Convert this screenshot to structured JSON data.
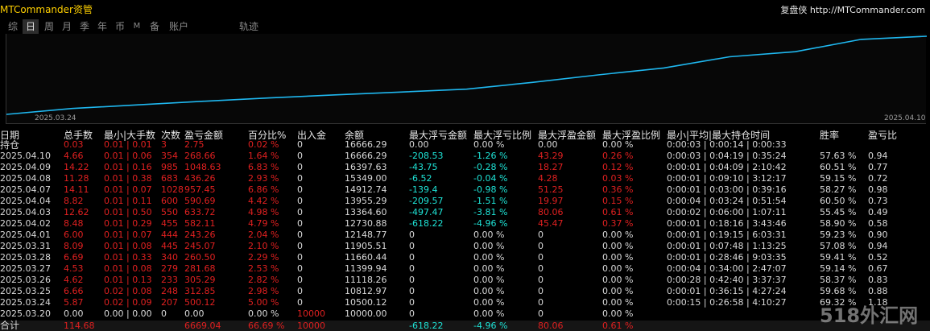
{
  "app": {
    "title": "MTCommander资管",
    "brand": "复盘侠 http://MTCommander.com"
  },
  "tabs": [
    {
      "label": "综",
      "active": false
    },
    {
      "label": "日",
      "active": true
    },
    {
      "label": "周",
      "active": false
    },
    {
      "label": "月",
      "active": false
    },
    {
      "label": "季",
      "active": false
    },
    {
      "label": "年",
      "active": false
    },
    {
      "label": "币",
      "active": false
    },
    {
      "label": "M",
      "active": false
    },
    {
      "label": "备",
      "active": false
    },
    {
      "label": "账户",
      "active": false
    },
    {
      "label": "轨迹",
      "active": false
    }
  ],
  "equity_chart": {
    "start_date": "2025.03.24",
    "end_date": "2025.04.10",
    "line_color": "#1fb8f0"
  },
  "table": {
    "headers": [
      "日期",
      "总手数",
      "最小|大手数",
      "次数",
      "盈亏金额",
      "百分比%",
      "出入金",
      "余额",
      "最大浮亏金额",
      "最大浮亏比例",
      "最大浮盈金额",
      "最大浮盈比例",
      "最小|平均|最大持仓时间",
      "胜率",
      "盈亏比"
    ],
    "holding_row": {
      "label": "持仓",
      "lots": "0.03",
      "min_max": "0.01 | 0.01",
      "count": "3",
      "pnl": "2.75",
      "pct": "0.02 %",
      "cash": "0",
      "balance": "16666.29",
      "max_float_loss": "0.00",
      "max_float_loss_pct": "0.00 %",
      "max_float_profit": "0.00",
      "max_float_profit_pct": "0.00 %",
      "hold_time": "0:00:03 | 0:00:14 | 0:00:33",
      "win_rate": "",
      "pl_ratio": ""
    },
    "rows": [
      {
        "date": "2025.04.10",
        "lots": "4.66",
        "min_max": "0.01 | 0.06",
        "count": "354",
        "pnl": "268.66",
        "pct": "1.64 %",
        "cash": "0",
        "balance": "16666.29",
        "mfl": "-208.53",
        "mflp": "-1.26 %",
        "mfp": "43.29",
        "mfpp": "0.26 %",
        "time": "0:00:03 | 0:04:19 | 0:35:24",
        "win": "57.63 %",
        "plr": "0.94",
        "pos": true
      },
      {
        "date": "2025.04.09",
        "lots": "14.22",
        "min_max": "0.01 | 0.16",
        "count": "985",
        "pnl": "1048.63",
        "pct": "6.83 %",
        "cash": "0",
        "balance": "16397.63",
        "mfl": "-43.75",
        "mflp": "-0.28 %",
        "mfp": "18.27",
        "mfpp": "0.12 %",
        "time": "0:00:01 | 0:04:09 | 2:10:42",
        "win": "60.51 %",
        "plr": "0.77",
        "pos": true
      },
      {
        "date": "2025.04.08",
        "lots": "11.28",
        "min_max": "0.01 | 0.38",
        "count": "683",
        "pnl": "436.26",
        "pct": "2.93 %",
        "cash": "0",
        "balance": "15349.00",
        "mfl": "-6.52",
        "mflp": "-0.04 %",
        "mfp": "4.28",
        "mfpp": "0.03 %",
        "time": "0:00:01 | 0:09:10 | 3:12:17",
        "win": "59.15 %",
        "plr": "0.72",
        "pos": true
      },
      {
        "date": "2025.04.07",
        "lots": "14.11",
        "min_max": "0.01 | 0.07",
        "count": "1028",
        "pnl": "957.45",
        "pct": "6.86 %",
        "cash": "0",
        "balance": "14912.74",
        "mfl": "-139.4",
        "mflp": "-0.98 %",
        "mfp": "51.25",
        "mfpp": "0.36 %",
        "time": "0:00:01 | 0:03:00 | 0:39:16",
        "win": "58.27 %",
        "plr": "0.98",
        "pos": true
      },
      {
        "date": "2025.04.04",
        "lots": "8.82",
        "min_max": "0.01 | 0.11",
        "count": "600",
        "pnl": "590.69",
        "pct": "4.42 %",
        "cash": "0",
        "balance": "13955.29",
        "mfl": "-209.57",
        "mflp": "-1.51 %",
        "mfp": "19.97",
        "mfpp": "0.15 %",
        "time": "0:00:04 | 0:03:24 | 0:51:54",
        "win": "60.50 %",
        "plr": "0.73",
        "pos": true
      },
      {
        "date": "2025.04.03",
        "lots": "12.62",
        "min_max": "0.01 | 0.50",
        "count": "550",
        "pnl": "633.72",
        "pct": "4.98 %",
        "cash": "0",
        "balance": "13364.60",
        "mfl": "-497.47",
        "mflp": "-3.81 %",
        "mfp": "80.06",
        "mfpp": "0.61 %",
        "time": "0:00:02 | 0:06:00 | 1:07:11",
        "win": "55.45 %",
        "plr": "0.49",
        "pos": true
      },
      {
        "date": "2025.04.02",
        "lots": "8.48",
        "min_max": "0.01 | 0.29",
        "count": "455",
        "pnl": "582.11",
        "pct": "4.79 %",
        "cash": "0",
        "balance": "12730.88",
        "mfl": "-618.22",
        "mflp": "-4.96 %",
        "mfp": "45.47",
        "mfpp": "0.37 %",
        "time": "0:00:01 | 0:18:16 | 3:43:46",
        "win": "58.90 %",
        "plr": "0.58",
        "pos": true
      },
      {
        "date": "2025.04.01",
        "lots": "6.00",
        "min_max": "0.01 | 0.07",
        "count": "444",
        "pnl": "243.26",
        "pct": "2.04 %",
        "cash": "0",
        "balance": "12148.77",
        "mfl": "0",
        "mflp": "0.00 %",
        "mfp": "0",
        "mfpp": "0.00 %",
        "time": "0:00:01 | 0:19:15 | 6:03:31",
        "win": "59.23 %",
        "plr": "0.90",
        "pos": true
      },
      {
        "date": "2025.03.31",
        "lots": "8.09",
        "min_max": "0.01 | 0.08",
        "count": "445",
        "pnl": "245.07",
        "pct": "2.10 %",
        "cash": "0",
        "balance": "11905.51",
        "mfl": "0",
        "mflp": "0.00 %",
        "mfp": "0",
        "mfpp": "0.00 %",
        "time": "0:00:01 | 0:07:48 | 1:13:25",
        "win": "57.08 %",
        "plr": "0.94",
        "pos": true
      },
      {
        "date": "2025.03.28",
        "lots": "6.69",
        "min_max": "0.01 | 0.33",
        "count": "340",
        "pnl": "260.50",
        "pct": "2.29 %",
        "cash": "0",
        "balance": "11660.44",
        "mfl": "0",
        "mflp": "0.00 %",
        "mfp": "0",
        "mfpp": "0.00 %",
        "time": "0:00:01 | 0:28:46 | 9:03:35",
        "win": "59.41 %",
        "plr": "0.52",
        "pos": true
      },
      {
        "date": "2025.03.27",
        "lots": "4.53",
        "min_max": "0.01 | 0.08",
        "count": "279",
        "pnl": "281.68",
        "pct": "2.53 %",
        "cash": "0",
        "balance": "11399.94",
        "mfl": "0",
        "mflp": "0.00 %",
        "mfp": "0",
        "mfpp": "0.00 %",
        "time": "0:00:04 | 0:34:00 | 2:47:07",
        "win": "59.14 %",
        "plr": "0.67",
        "pos": true
      },
      {
        "date": "2025.03.26",
        "lots": "4.62",
        "min_max": "0.01 | 0.13",
        "count": "233",
        "pnl": "305.29",
        "pct": "2.82 %",
        "cash": "0",
        "balance": "11118.26",
        "mfl": "0",
        "mflp": "0.00 %",
        "mfp": "0",
        "mfpp": "0.00 %",
        "time": "0:00:28 | 0:42:40 | 3:37:37",
        "win": "58.37 %",
        "plr": "0.83",
        "pos": true
      },
      {
        "date": "2025.03.25",
        "lots": "6.66",
        "min_max": "0.02 | 0.08",
        "count": "248",
        "pnl": "312.85",
        "pct": "2.98 %",
        "cash": "0",
        "balance": "10812.97",
        "mfl": "0",
        "mflp": "0.00 %",
        "mfp": "0",
        "mfpp": "0.00 %",
        "time": "0:00:01 | 0:36:15 | 4:27:24",
        "win": "59.68 %",
        "plr": "0.88",
        "pos": true
      },
      {
        "date": "2025.03.24",
        "lots": "5.87",
        "min_max": "0.02 | 0.09",
        "count": "207",
        "pnl": "500.12",
        "pct": "5.00 %",
        "cash": "0",
        "balance": "10500.12",
        "mfl": "0",
        "mflp": "0.00 %",
        "mfp": "0",
        "mfpp": "0.00 %",
        "time": "0:00:15 | 0:26:58 | 4:10:27",
        "win": "69.32 %",
        "plr": "1.18",
        "pos": true
      },
      {
        "date": "2025.03.20",
        "lots": "0.00",
        "min_max": "0.00 | 0.00",
        "count": "0",
        "pnl": "0.00",
        "pct": "0.00 %",
        "cash": "10000",
        "balance": "10000.00",
        "mfl": "0",
        "mflp": "0.00 %",
        "mfp": "0",
        "mfpp": "0.00 %",
        "time": "",
        "win": "",
        "plr": "",
        "pos": false
      }
    ],
    "total": {
      "label": "合计",
      "lots": "114.68",
      "pnl": "6669.04",
      "pct": "66.69 %",
      "cash": "10000",
      "mfl": "-618.22",
      "mflp": "-4.96 %",
      "mfp": "80.06",
      "mfpp": "0.61 %"
    }
  },
  "watermark": "518外汇网",
  "colors": {
    "positive": "#e02020",
    "negative_float": "#1ee3d6",
    "neutral": "#d9d9d9",
    "title": "#ffd000",
    "equity_line": "#1fb8f0"
  }
}
